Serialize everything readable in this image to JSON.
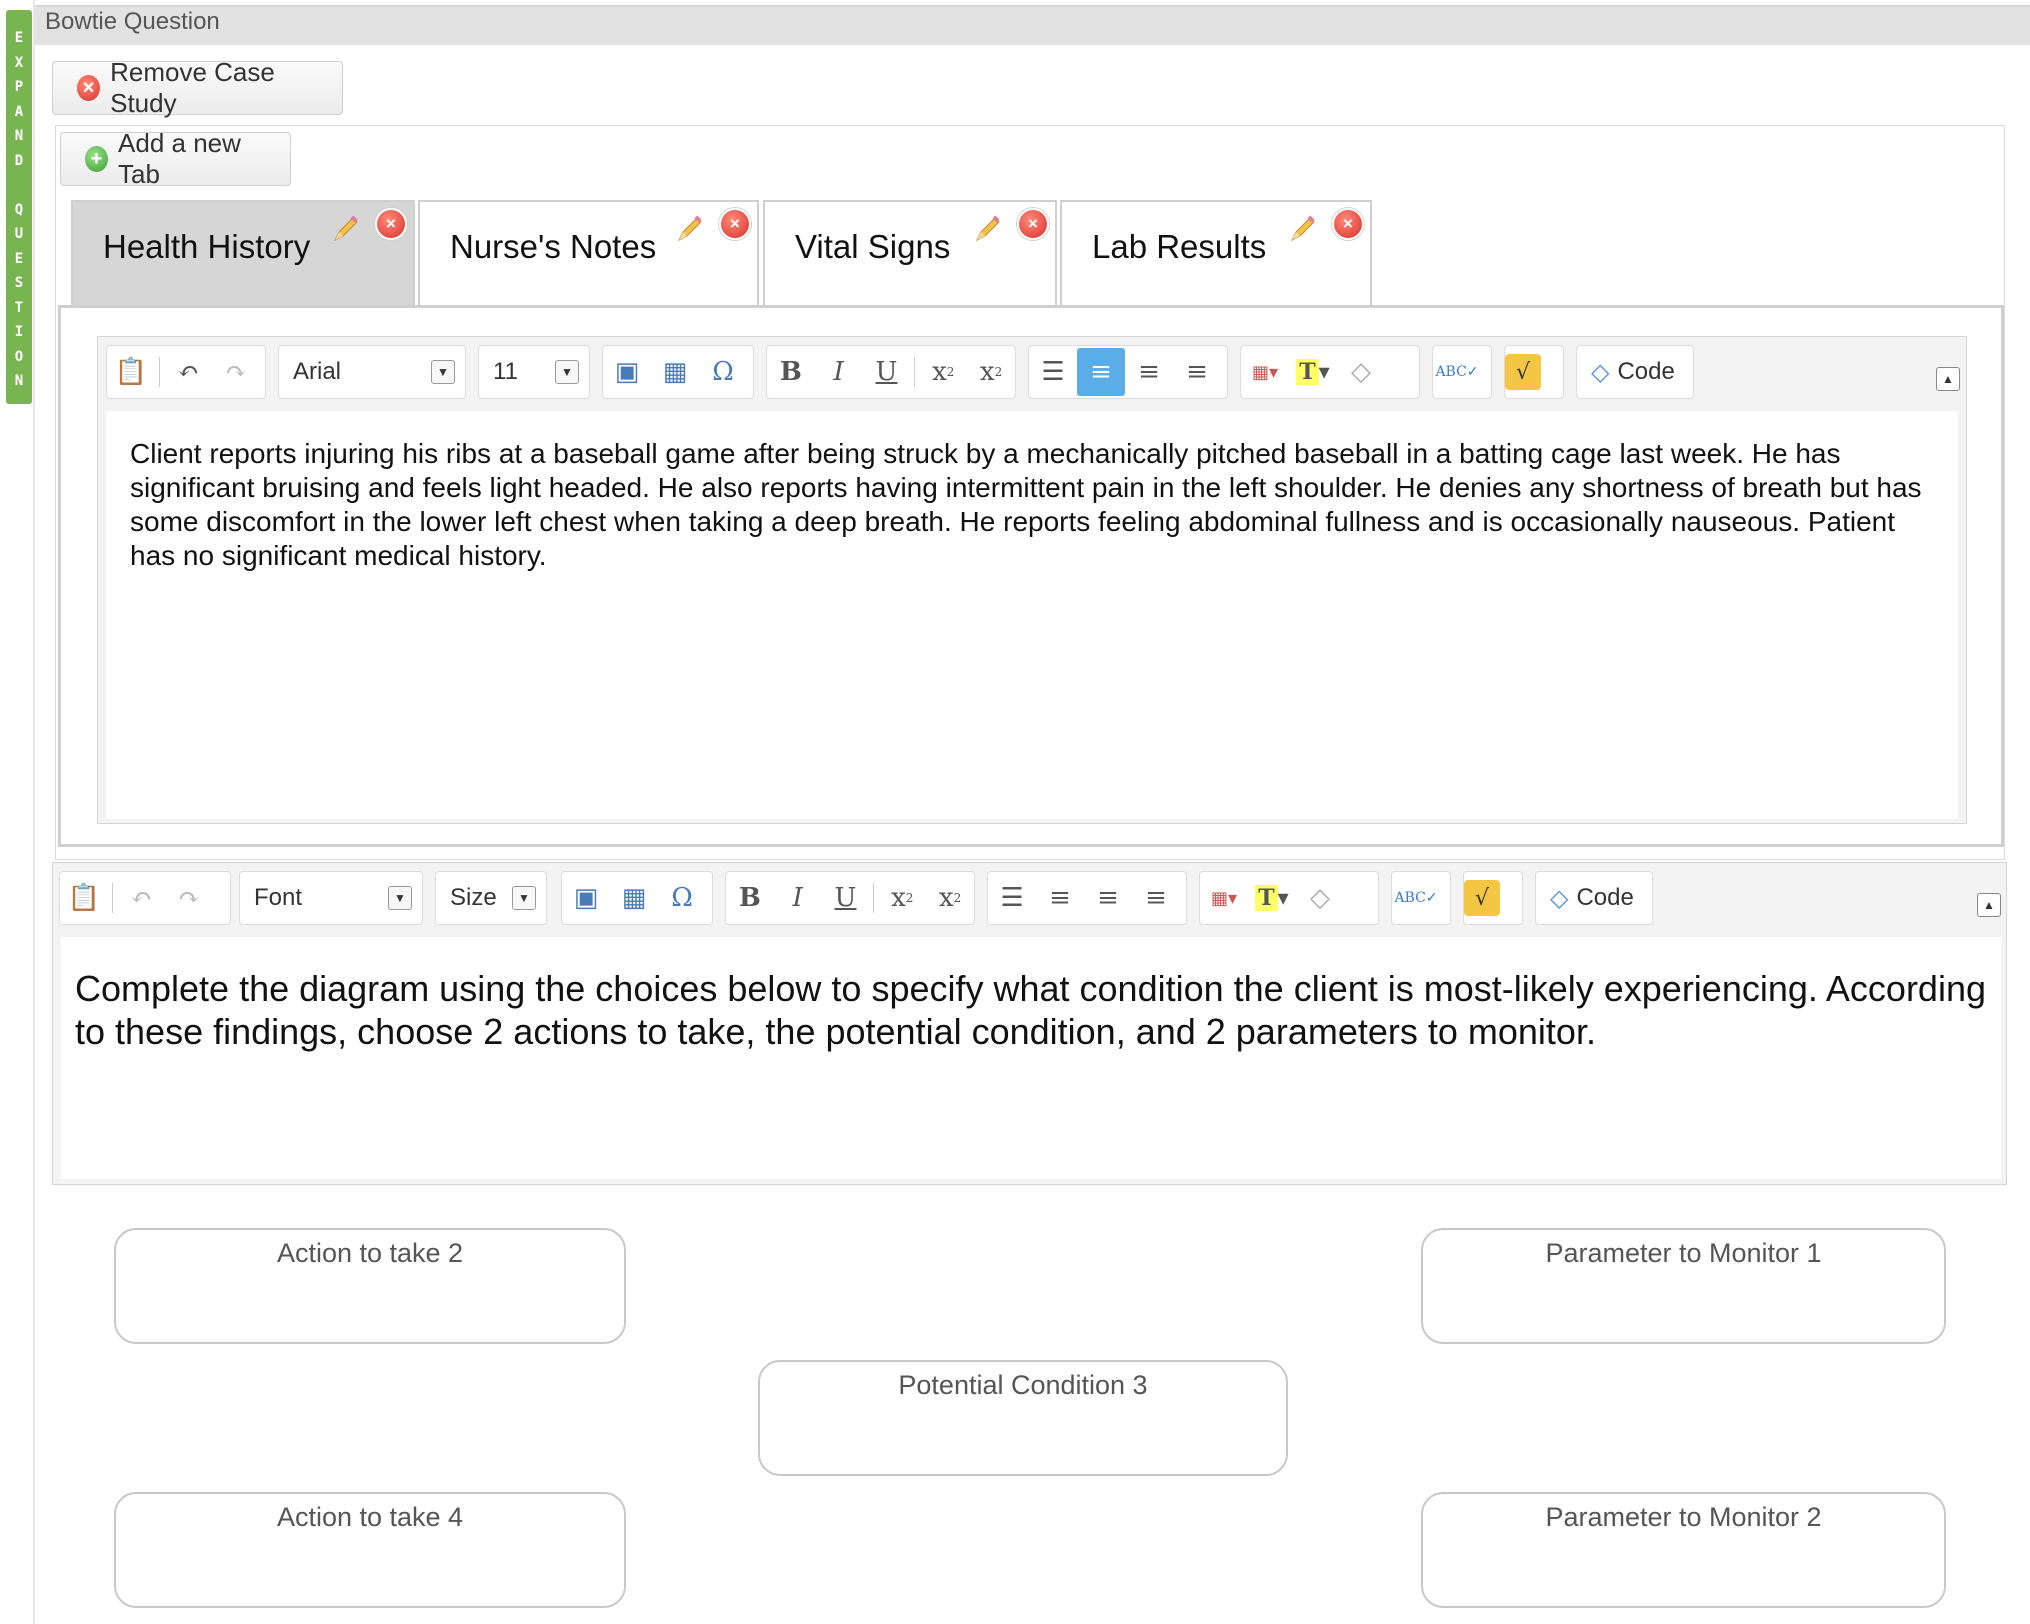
{
  "sidebar": {
    "expand_letters": [
      "E",
      "X",
      "P",
      "A",
      "N",
      "D",
      "",
      "Q",
      "U",
      "E",
      "S",
      "T",
      "I",
      "O",
      "N"
    ]
  },
  "header": {
    "title": "Bowtie Question"
  },
  "actions": {
    "remove_case_study": "Remove Case Study",
    "add_new_tab": "Add a new Tab"
  },
  "tabs": [
    {
      "label": "Health History",
      "active": true
    },
    {
      "label": "Nurse's Notes",
      "active": false
    },
    {
      "label": "Vital Signs",
      "active": false
    },
    {
      "label": "Lab Results",
      "active": false
    }
  ],
  "case_editor": {
    "font": "Arial",
    "size": "11",
    "code_label": "Code",
    "text": "Client reports injuring his ribs at a baseball game after being struck by a mechanically pitched baseball in a batting cage last week. He has significant bruising and feels light headed. He also reports having intermittent pain in the left shoulder. He denies any shortness of breath but has some discomfort in the lower left chest when taking a deep breath. He reports feeling abdominal fullness and is occasionally nauseous. Patient has no significant medical history."
  },
  "question_editor": {
    "font": "Font",
    "size": "Size",
    "code_label": "Code",
    "text": "Complete the diagram using the choices below to specify what condition the client is most-likely experiencing. According to these findings, choose 2 actions to take, the potential condition, and 2 parameters to monitor."
  },
  "bowtie": {
    "action_top": "Action to take 2",
    "action_bottom": "Action to take 4",
    "condition": "Potential Condition 3",
    "param_top": "Parameter to Monitor 1",
    "param_bottom": "Parameter to Monitor 2"
  },
  "colors": {
    "expand_strip": "#78b450",
    "selected_tool": "#5aaee8",
    "active_tab": "#d6d6d6"
  }
}
